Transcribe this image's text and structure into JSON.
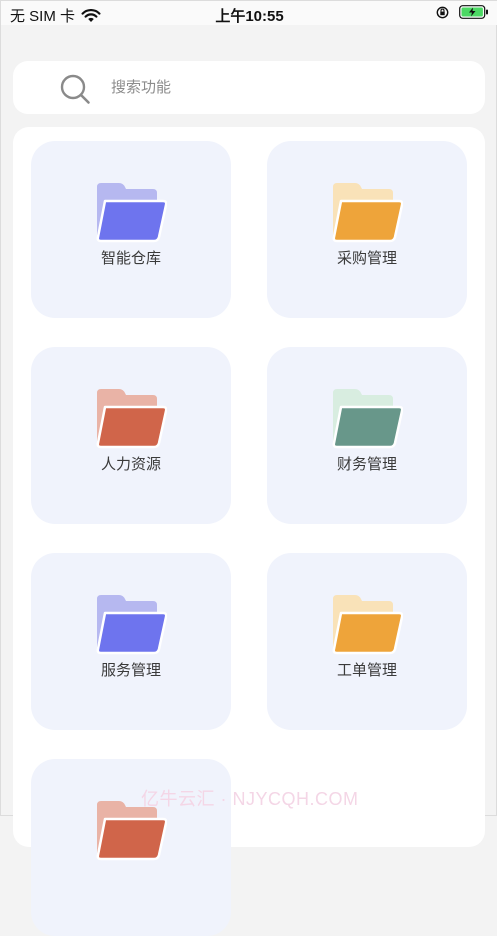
{
  "status_bar": {
    "carrier": "无 SIM 卡",
    "time": "上午10:55"
  },
  "search": {
    "placeholder": "搜索功能"
  },
  "tiles": [
    {
      "label": "智能仓库",
      "icon": "folder-icon",
      "color_back": "#b6b8f0",
      "color_front": "#6e74ee"
    },
    {
      "label": "采购管理",
      "icon": "folder-icon",
      "color_back": "#f9e2b8",
      "color_front": "#eea43a"
    },
    {
      "label": "人力资源",
      "icon": "folder-icon",
      "color_back": "#e9b3a6",
      "color_front": "#d0654a"
    },
    {
      "label": "财务管理",
      "icon": "folder-icon",
      "color_back": "#d8ede0",
      "color_front": "#68978a"
    },
    {
      "label": "服务管理",
      "icon": "folder-icon",
      "color_back": "#b6b8f0",
      "color_front": "#6e74ee"
    },
    {
      "label": "工单管理",
      "icon": "folder-icon",
      "color_back": "#f9e2b8",
      "color_front": "#eea43a"
    },
    {
      "label": "",
      "icon": "folder-icon",
      "color_back": "#e9b3a6",
      "color_front": "#d0654a"
    }
  ],
  "watermark": "亿牛云汇 · NJYCQH.COM"
}
